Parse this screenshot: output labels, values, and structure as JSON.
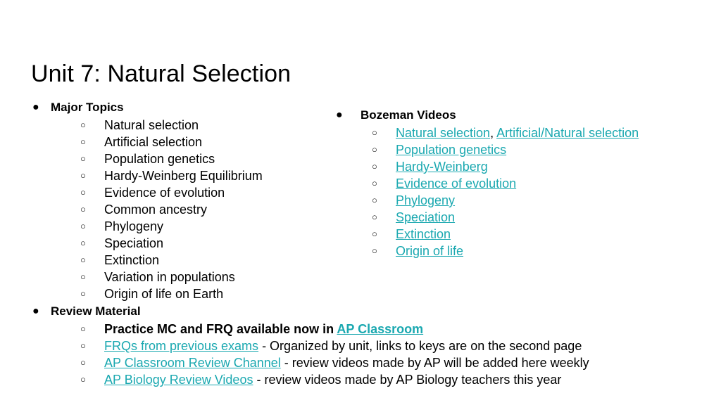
{
  "slide": {
    "title": "Unit 7: Natural Selection",
    "bullet_filled": "●",
    "bullet_hollow": "○",
    "link_color": "#1aa8b0",
    "text_color": "#000000",
    "background_color": "#ffffff"
  },
  "left_column": {
    "sections": [
      {
        "heading": "Major Topics",
        "items": [
          {
            "text": "Natural selection"
          },
          {
            "text": "Artificial selection"
          },
          {
            "text": "Population genetics"
          },
          {
            "text": "Hardy-Weinberg Equilibrium"
          },
          {
            "text": "Evidence of evolution"
          },
          {
            "text": "Common ancestry"
          },
          {
            "text": "Phylogeny"
          },
          {
            "text": "Speciation"
          },
          {
            "text": "Extinction"
          },
          {
            "text": "Variation in populations"
          },
          {
            "text": "Origin of life on Earth"
          }
        ]
      },
      {
        "heading": "Review Material",
        "items": [
          {
            "bold": true,
            "prefix": "Practice MC and FRQ available now in ",
            "link": "AP Classroom",
            "suffix": ""
          },
          {
            "bold": false,
            "prefix": "",
            "link": "FRQs from previous exams",
            "suffix": " - Organized by unit, links to keys are on the second page"
          },
          {
            "bold": false,
            "prefix": "",
            "link": "AP Classroom Review Channel",
            "suffix": " - review videos made by AP will be added here weekly"
          },
          {
            "bold": false,
            "prefix": "",
            "link": "AP Biology Review Videos",
            "suffix": " - review videos made by AP Biology teachers this year"
          }
        ]
      }
    ]
  },
  "right_column": {
    "heading": "Bozeman Videos",
    "items": [
      {
        "links": [
          "Natural selection",
          "Artificial/Natural selection"
        ],
        "separator": ", "
      },
      {
        "links": [
          "Population genetics"
        ],
        "separator": ""
      },
      {
        "links": [
          "Hardy-Weinberg"
        ],
        "separator": ""
      },
      {
        "links": [
          "Evidence of evolution"
        ],
        "separator": ""
      },
      {
        "links": [
          "Phylogeny"
        ],
        "separator": ""
      },
      {
        "links": [
          "Speciation"
        ],
        "separator": ""
      },
      {
        "links": [
          "Extinction"
        ],
        "separator": ""
      },
      {
        "links": [
          "Origin of life"
        ],
        "separator": ""
      }
    ]
  }
}
